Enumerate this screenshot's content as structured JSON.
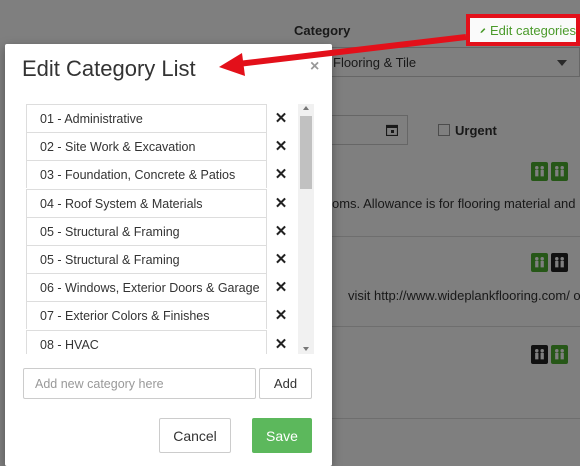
{
  "background": {
    "category_label": "Category",
    "edit_categories_label": "Edit categories",
    "category_select_value": "Flooring & Tile",
    "urgent_label": "Urgent",
    "note_1": "oms. Allowance is for flooring material and",
    "note_2": "visit http://www.wideplankflooring.com/ or"
  },
  "modal": {
    "title": "Edit Category List",
    "close_symbol": "×",
    "delete_symbol": "✕",
    "categories": [
      "01 - Administrative",
      "02 - Site Work & Excavation",
      "03 - Foundation, Concrete & Patios",
      "04 - Roof System & Materials",
      "05 - Structural &  Framing",
      "05 - Structural & Framing",
      "06 - Windows, Exterior Doors & Garage",
      "07 - Exterior Colors & Finishes",
      "08 - HVAC"
    ],
    "new_category_placeholder": "Add new category here",
    "add_label": "Add",
    "cancel_label": "Cancel",
    "save_label": "Save"
  },
  "colors": {
    "save_green": "#5cb85c",
    "highlight_red": "#e3101a",
    "edit_link_green": "#4a9a2a",
    "badge_green": "#4caf2f"
  }
}
